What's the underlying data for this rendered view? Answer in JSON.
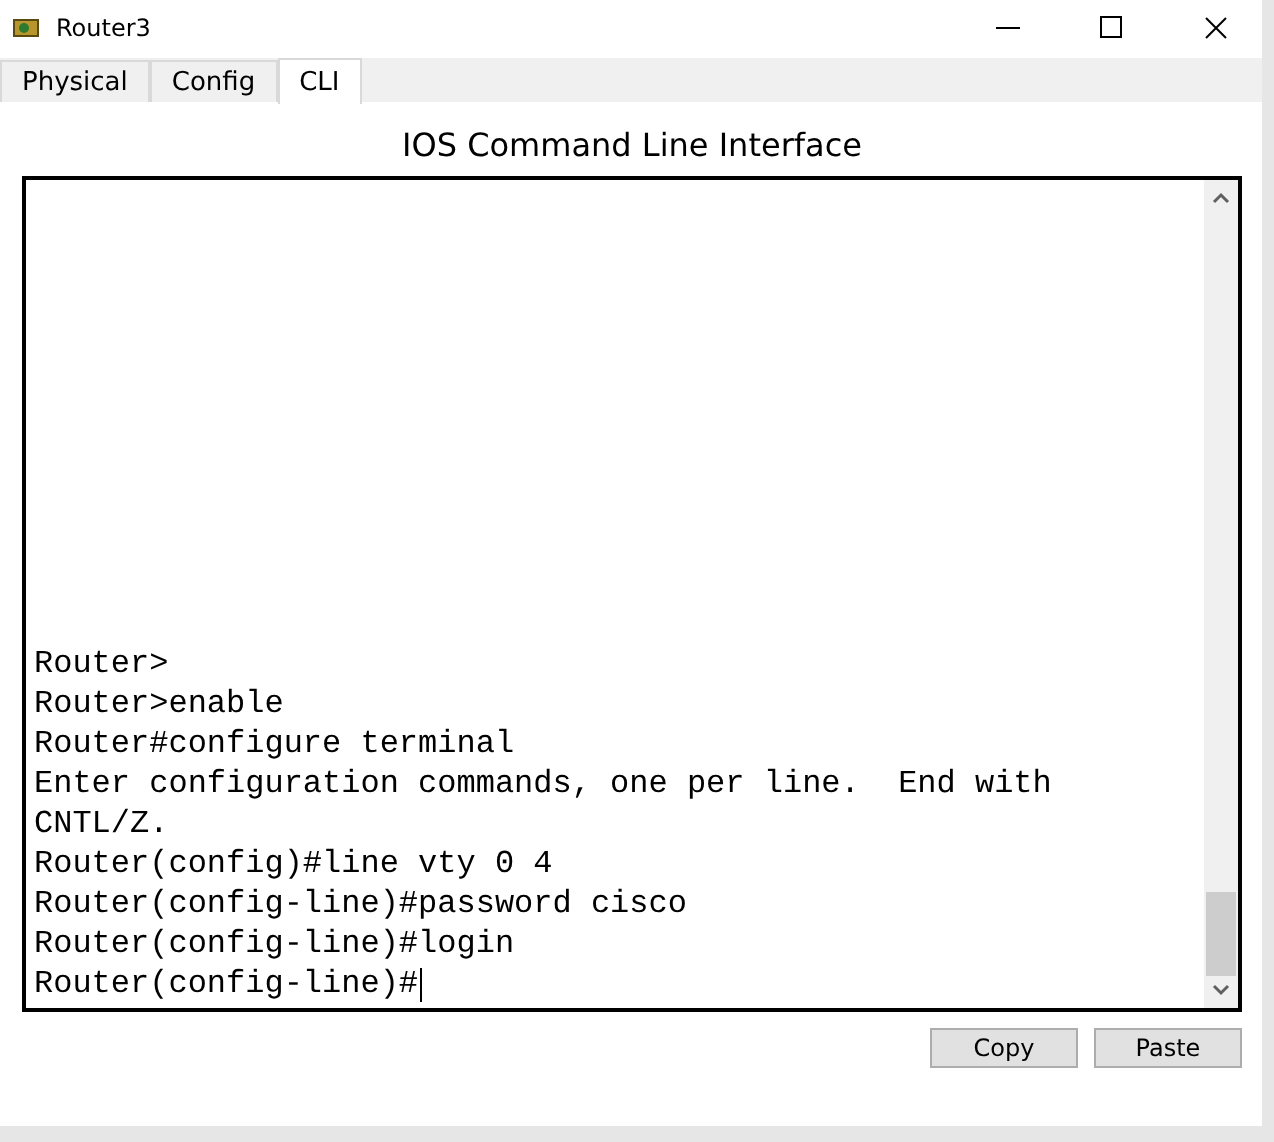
{
  "window": {
    "title": "Router3"
  },
  "tabs": [
    {
      "label": "Physical",
      "selected": false
    },
    {
      "label": "Config",
      "selected": false
    },
    {
      "label": "CLI",
      "selected": true
    }
  ],
  "heading": "IOS Command Line Interface",
  "terminal": {
    "lines": [
      "Router>",
      "Router>enable",
      "Router#configure terminal",
      "Enter configuration commands, one per line.  End with",
      "CNTL/Z.",
      "Router(config)#line vty 0 4",
      "Router(config-line)#password cisco",
      "Router(config-line)#login",
      "Router(config-line)#"
    ]
  },
  "buttons": [
    "Copy",
    "Paste"
  ]
}
